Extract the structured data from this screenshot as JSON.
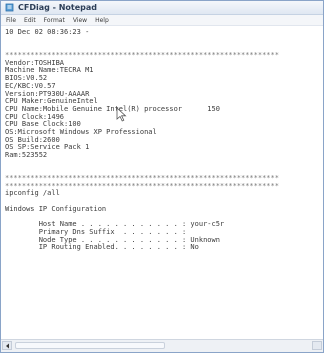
{
  "window": {
    "title": "CFDiag - Notepad"
  },
  "menu": {
    "items": [
      "File",
      "Edit",
      "Format",
      "View",
      "Help"
    ]
  },
  "content": {
    "lines": [
      "10 Dec 02 08:36:23 -",
      "",
      "",
      "*****************************************************************",
      "Vendor:TOSHIBA",
      "Machine Name:TECRA M1",
      "BIOS:V0.52",
      "EC/KBC:V0.57",
      "Version:PT930U-AAAAR",
      "CPU Maker:GenuineIntel",
      "CPU Name:Mobile Genuine Intel(R) processor      150",
      "CPU Clock:1496",
      "CPU Base Clock:100",
      "OS:Microsoft Windows XP Professional",
      "OS Build:2600",
      "OS SP:Service Pack 1",
      "Ram:523552",
      "",
      "",
      "*****************************************************************",
      "*****************************************************************",
      "ipconfig /all",
      "",
      "Windows IP Configuration",
      "",
      "        Host Name . . . . . . . . . . . . : your-c5r",
      "        Primary Dns Suffix  . . . . . . . :",
      "        Node Type . . . . . . . . . . . . : Unknown",
      "        IP Routing Enabled. . . . . . . . : No"
    ]
  }
}
